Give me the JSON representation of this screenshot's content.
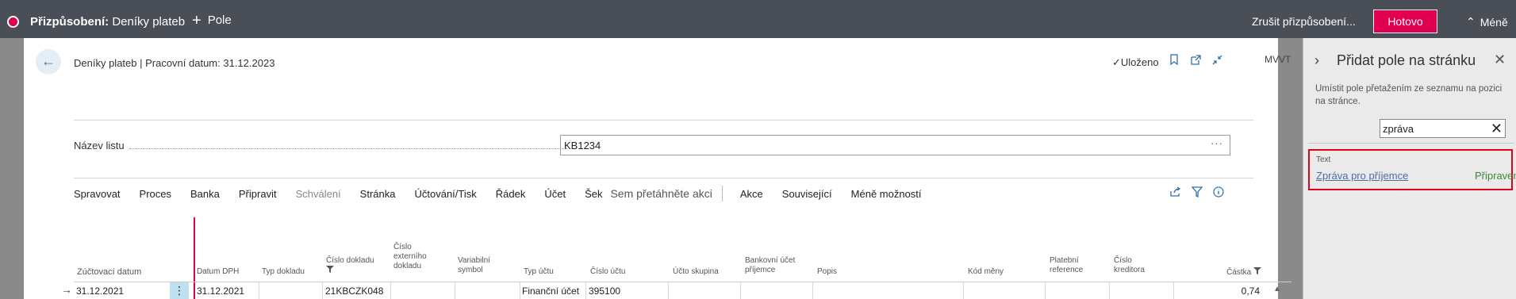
{
  "topbar": {
    "title_bold": "Přizpůsobení:",
    "title_rest": " Deníky plateb",
    "add_field_label": "Pole",
    "cancel_label": "Zrušit přizpůsobení...",
    "done_label": "Hotovo",
    "less_label": "Méně"
  },
  "header": {
    "breadcrumb": "Deníky plateb | Pracovní datum: 31.12.2023",
    "saved_label": "Uloženo",
    "user_initials": "MVVT"
  },
  "form": {
    "sheet_label": "Název listu",
    "sheet_value": "KB1234"
  },
  "actions": {
    "items": [
      {
        "label": "Spravovat",
        "dim": false
      },
      {
        "label": "Proces",
        "dim": false
      },
      {
        "label": "Banka",
        "dim": false
      },
      {
        "label": "Připravit",
        "dim": false
      },
      {
        "label": "Schválení",
        "dim": true
      },
      {
        "label": "Stránka",
        "dim": false
      },
      {
        "label": "Účtování/Tisk",
        "dim": false
      },
      {
        "label": "Řádek",
        "dim": false
      },
      {
        "label": "Účet",
        "dim": false
      },
      {
        "label": "Šek",
        "dim": false
      }
    ],
    "drop_hint": "Sem přetáhněte akci",
    "after": [
      {
        "label": "Akce",
        "dim": false
      },
      {
        "label": "Související",
        "dim": false
      },
      {
        "label": "Méně možností",
        "dim": false
      }
    ]
  },
  "grid": {
    "columns": {
      "posting_date": "Zúčtovací datum",
      "vat_date": "Datum DPH",
      "doc_type": "Typ dokladu",
      "doc_no": "Číslo dokladu",
      "ext_doc_no": "Číslo externího dokladu",
      "var_symbol": "Variabilní symbol",
      "acc_type": "Typ účtu",
      "acc_no": "Číslo účtu",
      "acc_group": "Účto skupina",
      "bank_acc": "Bankovní účet příjemce",
      "desc": "Popis",
      "currency": "Kód měny",
      "pay_ref": "Platební reference",
      "vendor_no": "Číslo kreditora",
      "amount": "Částka"
    },
    "row": {
      "posting_date": "31.12.2021",
      "vat_date": "31.12.2021",
      "doc_no": "21KBCZK048",
      "acc_type": "Finanční účet",
      "acc_no": "395100",
      "amount": "0,74"
    }
  },
  "panel": {
    "title": "Přidat pole na stránku",
    "description": "Umístit pole přetažením ze seznamu na pozici na stránce.",
    "search_value": "zpráva",
    "result_group": "Text",
    "result_name": "Zpráva pro příjemce",
    "result_state": "Připraveno"
  },
  "colors": {
    "accent": "#e10050",
    "bar": "#4a4e57",
    "link": "#2f6fb0"
  }
}
